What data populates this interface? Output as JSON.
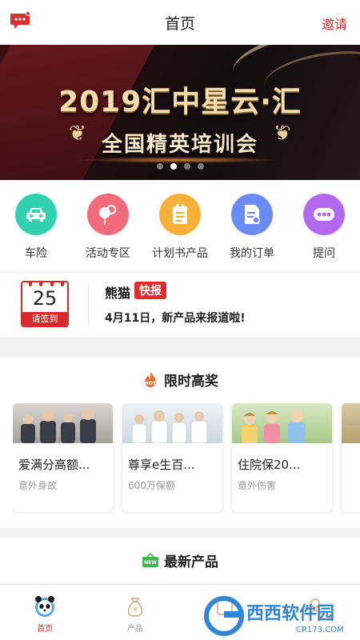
{
  "header": {
    "title": "首页",
    "invite_label": "邀请",
    "message_icon": "chat-bubble-icon"
  },
  "banner": {
    "headline": "2019汇中星云·汇",
    "subline": "全国精英培训会",
    "slide_count": 4,
    "active_slide": 2
  },
  "quick_menu": [
    {
      "label": "车险",
      "icon": "car-icon",
      "color": "#2fd1b0"
    },
    {
      "label": "活动专区",
      "icon": "balloon-icon",
      "color": "#f26b7a"
    },
    {
      "label": "计划书产品",
      "icon": "document-icon",
      "color": "#f7b03a"
    },
    {
      "label": "我的订单",
      "icon": "order-icon",
      "color": "#6b8cf5"
    },
    {
      "label": "提问",
      "icon": "chat-dots-icon",
      "color": "#b46af0"
    }
  ],
  "news": {
    "calendar_day": "25",
    "checkin_label": "请签到",
    "brand": "熊猫",
    "badge": "快报",
    "headline": "4月11日，新产品来报道啦!"
  },
  "hot_section": {
    "title": "限时高奖",
    "icon_label": "HOT",
    "products": [
      {
        "name": "爱满分高额...",
        "tag": "意外身故"
      },
      {
        "name": "尊享e生百...",
        "tag": "600万保额"
      },
      {
        "name": "住院保20...",
        "tag": "意外伤害"
      }
    ]
  },
  "new_section": {
    "title": "最新产品",
    "icon_label": "NEW"
  },
  "tabbar": [
    {
      "label": "首页",
      "icon": "panda-home-icon",
      "active": true
    },
    {
      "label": "产品",
      "icon": "money-bag-icon",
      "active": false
    },
    {
      "label": "",
      "icon": "calendar-icon",
      "active": false
    },
    {
      "label": "",
      "icon": "person-icon",
      "active": false
    }
  ],
  "watermark": {
    "text": "西西软件园",
    "url_text": "CR173.COM"
  }
}
